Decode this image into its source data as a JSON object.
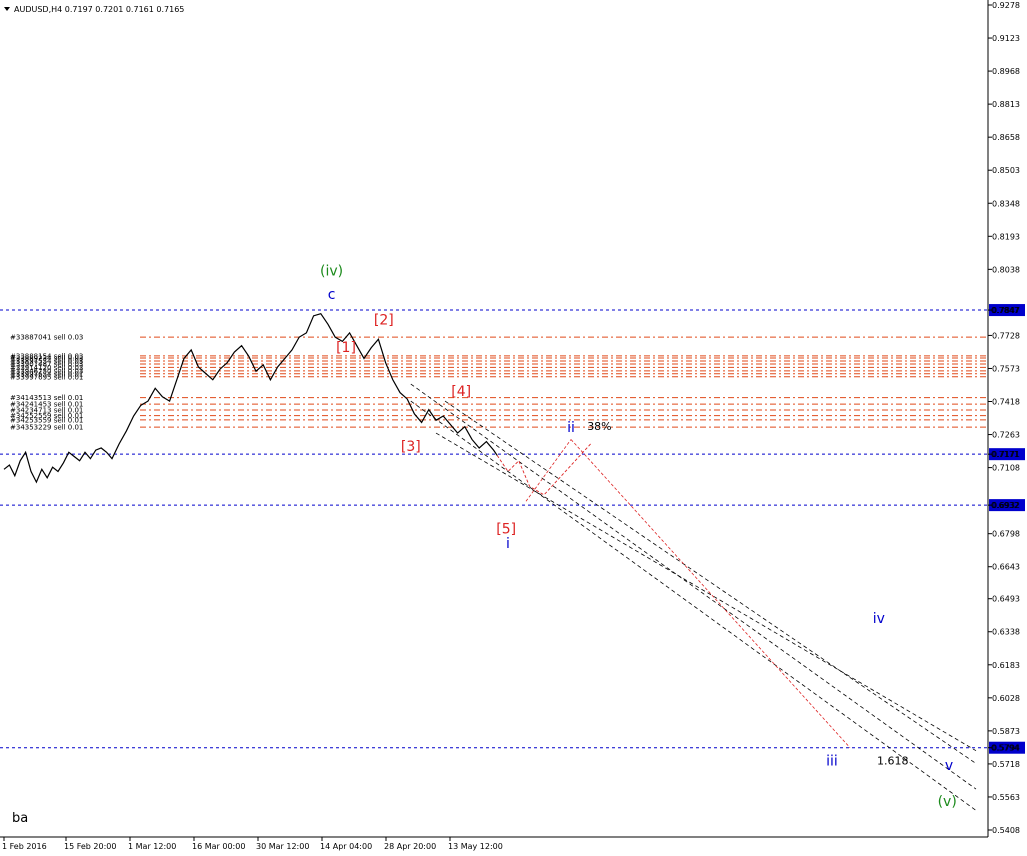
{
  "chart_data": {
    "type": "line",
    "title": "AUDUSD,H4  0.7197 0.7201 0.7161 0.7165",
    "symbol": "AUDUSD,H4",
    "ohlc": {
      "open": 0.7197,
      "high": 0.7201,
      "low": 0.7161,
      "close": 0.7165
    },
    "xlabel": "",
    "ylabel": "",
    "ylim": [
      0.5408,
      0.9278
    ],
    "y_ticks": [
      "0.9278",
      "0.9123",
      "0.8968",
      "0.8813",
      "0.8658",
      "0.8503",
      "0.8348",
      "0.8193",
      "0.8038",
      "0.7847",
      "0.7728",
      "0.7573",
      "0.7418",
      "0.7263",
      "0.7171",
      "0.7108",
      "0.6932",
      "0.6798",
      "0.6643",
      "0.6493",
      "0.6338",
      "0.6183",
      "0.6028",
      "0.5873",
      "0.5794",
      "0.5718",
      "0.5563",
      "0.5408"
    ],
    "x_ticks": [
      "1 Feb 2016",
      "15 Feb 20:00",
      "1 Mar 12:00",
      "16 Mar 00:00",
      "30 Mar 12:00",
      "14 Apr 04:00",
      "28 Apr 20:00",
      "13 May 12:00"
    ],
    "price_series": [
      [
        0,
        0.71
      ],
      [
        3,
        0.712
      ],
      [
        6,
        0.707
      ],
      [
        9,
        0.714
      ],
      [
        12,
        0.718
      ],
      [
        15,
        0.709
      ],
      [
        18,
        0.704
      ],
      [
        21,
        0.71
      ],
      [
        24,
        0.706
      ],
      [
        27,
        0.711
      ],
      [
        30,
        0.709
      ],
      [
        33,
        0.713
      ],
      [
        36,
        0.718
      ],
      [
        39,
        0.716
      ],
      [
        42,
        0.714
      ],
      [
        45,
        0.718
      ],
      [
        48,
        0.715
      ],
      [
        51,
        0.719
      ],
      [
        54,
        0.72
      ],
      [
        57,
        0.718
      ],
      [
        60,
        0.715
      ],
      [
        64,
        0.722
      ],
      [
        68,
        0.728
      ],
      [
        72,
        0.735
      ],
      [
        76,
        0.74
      ],
      [
        80,
        0.742
      ],
      [
        84,
        0.748
      ],
      [
        88,
        0.744
      ],
      [
        92,
        0.742
      ],
      [
        96,
        0.752
      ],
      [
        100,
        0.762
      ],
      [
        104,
        0.766
      ],
      [
        108,
        0.758
      ],
      [
        112,
        0.755
      ],
      [
        116,
        0.752
      ],
      [
        120,
        0.757
      ],
      [
        124,
        0.76
      ],
      [
        128,
        0.765
      ],
      [
        132,
        0.768
      ],
      [
        136,
        0.763
      ],
      [
        140,
        0.756
      ],
      [
        144,
        0.759
      ],
      [
        148,
        0.752
      ],
      [
        152,
        0.758
      ],
      [
        156,
        0.762
      ],
      [
        160,
        0.766
      ],
      [
        164,
        0.772
      ],
      [
        168,
        0.774
      ],
      [
        172,
        0.782
      ],
      [
        176,
        0.783
      ],
      [
        180,
        0.778
      ],
      [
        184,
        0.772
      ],
      [
        188,
        0.77
      ],
      [
        192,
        0.774
      ],
      [
        196,
        0.768
      ],
      [
        200,
        0.762
      ],
      [
        204,
        0.767
      ],
      [
        208,
        0.771
      ],
      [
        212,
        0.76
      ],
      [
        216,
        0.752
      ],
      [
        220,
        0.746
      ],
      [
        224,
        0.743
      ],
      [
        228,
        0.736
      ],
      [
        232,
        0.732
      ],
      [
        236,
        0.738
      ],
      [
        240,
        0.733
      ],
      [
        244,
        0.735
      ],
      [
        248,
        0.731
      ],
      [
        252,
        0.727
      ],
      [
        256,
        0.73
      ],
      [
        260,
        0.724
      ],
      [
        264,
        0.72
      ],
      [
        268,
        0.723
      ],
      [
        272,
        0.719
      ],
      [
        274,
        0.7165
      ]
    ],
    "projection": [
      [
        274,
        0.7165
      ],
      [
        280,
        0.709
      ],
      [
        286,
        0.714
      ],
      [
        292,
        0.702
      ],
      [
        300,
        0.698
      ],
      [
        326,
        0.722
      ]
    ],
    "horizontal_lines": [
      {
        "value": 0.7847,
        "label": "0.7847",
        "color": "#0000cc"
      },
      {
        "value": 0.7171,
        "label": "0.7171",
        "color": "#0000cc"
      },
      {
        "value": 0.6932,
        "label": "0.6932",
        "color": "#0000cc"
      },
      {
        "value": 0.5794,
        "label": "0.5794",
        "color": "#0000cc"
      }
    ],
    "orders": [
      {
        "label": "#33887041 sell 0.03",
        "value": 0.772
      },
      {
        "label": "#33888154 sell 0.03",
        "value": 0.7632
      },
      {
        "label": "#33889234 sell 0.03",
        "value": 0.7622
      },
      {
        "label": "#33897554 sell 0.03",
        "value": 0.7608
      },
      {
        "label": "#33907487 sell 0.03",
        "value": 0.7594
      },
      {
        "label": "#33914120 sell 0.03",
        "value": 0.7578
      },
      {
        "label": "#33946750 sell 0.03",
        "value": 0.7562
      },
      {
        "label": "#33997654 sell 0.01",
        "value": 0.7548
      },
      {
        "label": "#33997695 sell 0.01",
        "value": 0.7534
      },
      {
        "label": "#34143513 sell 0.01",
        "value": 0.7436
      },
      {
        "label": "#34241453 sell 0.01",
        "value": 0.7406
      },
      {
        "label": "#34234713 sell 0.01",
        "value": 0.7378
      },
      {
        "label": "#34252559 sell 0.01",
        "value": 0.7352
      },
      {
        "label": "#34253559 sell 0.01",
        "value": 0.7332
      },
      {
        "label": "#34353229 sell 0.01",
        "value": 0.7298
      }
    ],
    "wave_labels": [
      {
        "text": "(iv)",
        "t": 182,
        "v": 0.801,
        "color": "#1b8a1b"
      },
      {
        "text": "c",
        "t": 182,
        "v": 0.79,
        "color": "#0000cc"
      },
      {
        "text": "[2]",
        "t": 211,
        "v": 0.778,
        "color": "#dd2222"
      },
      {
        "text": "[1]",
        "t": 190,
        "v": 0.765,
        "color": "#dd2222"
      },
      {
        "text": "[4]",
        "t": 254,
        "v": 0.7445,
        "color": "#dd2222"
      },
      {
        "text": "[3]",
        "t": 226,
        "v": 0.7185,
        "color": "#dd2222"
      },
      {
        "text": "ii",
        "t": 315,
        "v": 0.7275,
        "color": "#0000cc"
      },
      {
        "text": "[5]",
        "t": 279,
        "v": 0.68,
        "color": "#dd2222"
      },
      {
        "text": "i",
        "t": 280,
        "v": 0.673,
        "color": "#0000cc"
      },
      {
        "text": "iv",
        "t": 486,
        "v": 0.638,
        "color": "#0000cc"
      },
      {
        "text": "iii",
        "t": 460,
        "v": 0.571,
        "color": "#0000cc"
      },
      {
        "text": "v",
        "t": 525,
        "v": 0.569,
        "color": "#0000cc"
      },
      {
        "text": "(v)",
        "t": 524,
        "v": 0.552,
        "color": "#1b8a1b"
      }
    ],
    "text_labels": [
      {
        "text": "38%",
        "t": 324,
        "v": 0.7285
      },
      {
        "text": "1.618",
        "t": 485,
        "v": 0.5715
      }
    ],
    "corner_text": "ba"
  },
  "colors": {
    "price": "#000000",
    "order_line": "#e04a1a",
    "level_line": "#0000cc",
    "channel": "#000000",
    "fib": "#dd2222",
    "label_bg": "#0000cc",
    "label_fg": "#ffffff"
  }
}
